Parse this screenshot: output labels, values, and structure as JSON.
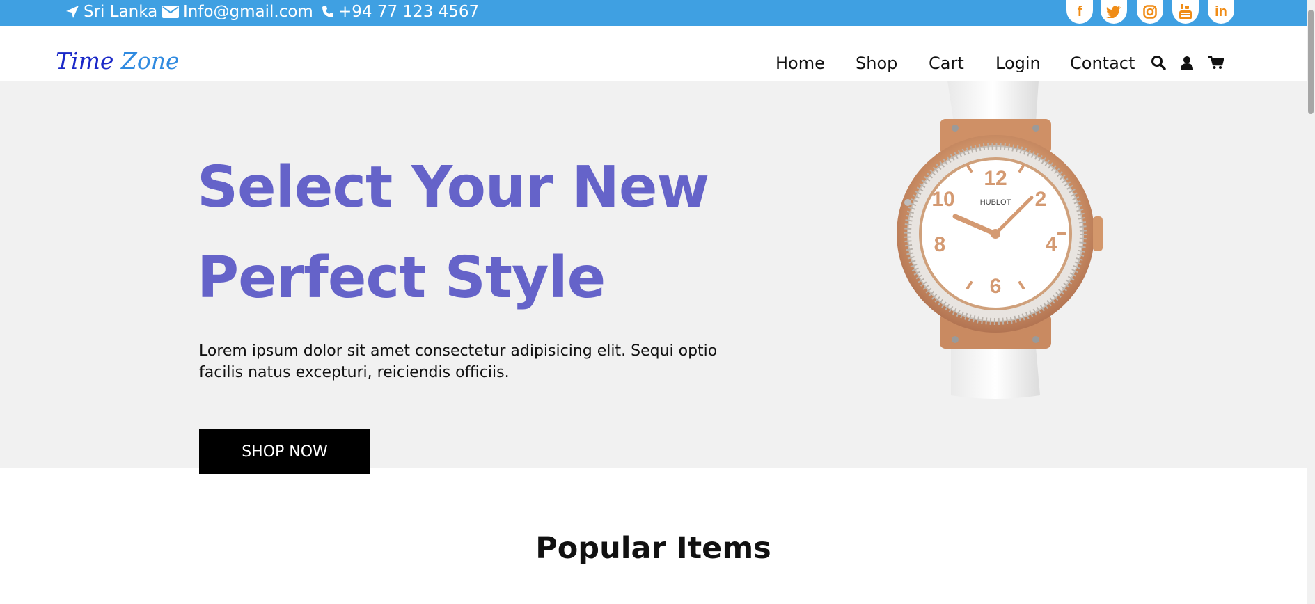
{
  "topbar": {
    "location": "Sri Lanka",
    "email": "Info@gmail.com",
    "phone": "+94 77 123 4567",
    "social": [
      {
        "icon": "facebook-icon",
        "glyph": "f"
      },
      {
        "icon": "twitter-icon",
        "glyph": "t"
      },
      {
        "icon": "instagram-icon",
        "glyph": ""
      },
      {
        "icon": "youtube-icon",
        "glyph": ""
      },
      {
        "icon": "linkedin-icon",
        "glyph": "in"
      }
    ]
  },
  "logo": {
    "part1": "Time",
    "part2": "Zone"
  },
  "nav": {
    "home": "Home",
    "shop": "Shop",
    "cart": "Cart",
    "login": "Login",
    "contact": "Contact"
  },
  "header_icons": [
    "search-icon",
    "user-icon",
    "cart-icon"
  ],
  "hero": {
    "title_line1": "Select Your New",
    "title_line2": "Perfect Style",
    "text": "Lorem ipsum dolor sit amet consectetur adipisicing elit. Sequi optio facilis natus excepturi, reiciendis officiis.",
    "button": "SHOP NOW",
    "watch_brand": "HUBLOT"
  },
  "section": {
    "title": "Popular Items"
  },
  "colors": {
    "topbar": "#3fa0e2",
    "social_icon": "#f08c16",
    "hero_title": "#6563c9",
    "hero_bg": "#f1f1f1"
  }
}
